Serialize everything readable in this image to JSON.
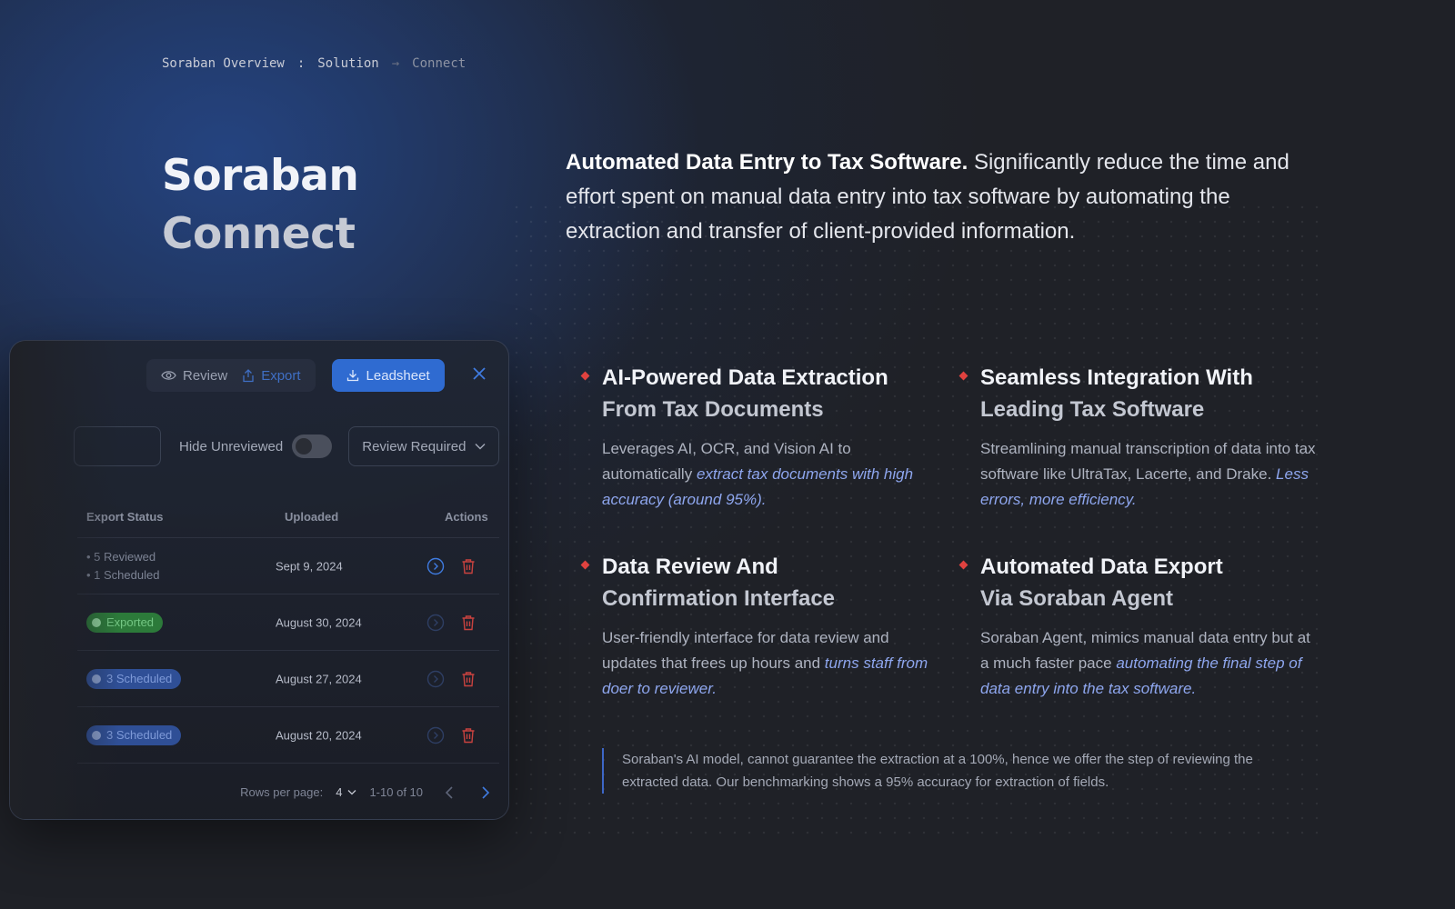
{
  "breadcrumb": {
    "item1": "Soraban Overview",
    "sep1": ":",
    "item2": "Solution",
    "sep2": "→",
    "item3": "Connect"
  },
  "title": {
    "line1": "Soraban",
    "line2": "Connect"
  },
  "intro": {
    "bold": "Automated Data Entry to Tax Software.",
    "rest": " Significantly reduce the time and effort spent on manual data entry into tax software by automating the extraction and transfer of client-provided information."
  },
  "panel": {
    "toolbar": {
      "review": "Review",
      "export": "Export",
      "leadsheet": "Leadsheet"
    },
    "filters": {
      "hide_unreviewed": "Hide Unreviewed",
      "select_value": "Review Required"
    },
    "columns": {
      "status": "Export Status",
      "uploaded": "Uploaded",
      "actions": "Actions"
    },
    "rows": [
      {
        "status_line1": "• 5 Reviewed",
        "status_line2": "• 1 Scheduled",
        "date": "Sept 9, 2024"
      },
      {
        "status": "Exported",
        "date": "August 30, 2024"
      },
      {
        "status": "3 Scheduled",
        "date": "August 27, 2024"
      },
      {
        "status": "3 Scheduled",
        "date": "August 20, 2024"
      }
    ],
    "footer": {
      "rows_per_page": "Rows per page:",
      "rows_value": "4",
      "range": "1-10 of 10"
    }
  },
  "features": [
    {
      "title_a": "AI-Powered Data Extraction",
      "title_b": "From Tax Documents",
      "text": "Leverages AI, OCR, and Vision AI to automatically ",
      "highlight": "extract tax documents with high accuracy (around 95%)."
    },
    {
      "title_a": "Seamless Integration With",
      "title_b": "Leading Tax Software",
      "text": "Streamlining manual transcription of data into tax software like UltraTax, Lacerte, and Drake. ",
      "highlight": "Less errors, more efficiency."
    },
    {
      "title_a": "Data Review And",
      "title_b": "Confirmation Interface",
      "text": "User-friendly interface for data review and updates that frees up hours and ",
      "highlight": "turns staff from doer to reviewer."
    },
    {
      "title_a": "Automated Data Export",
      "title_b": "Via Soraban Agent",
      "text": "Soraban Agent, mimics manual data entry but at a much faster pace  ",
      "highlight": "automating the final step of data entry into the tax software."
    }
  ],
  "note": "Soraban's AI model, cannot guarantee the extraction at a 100%, hence we offer the step of reviewing the extracted data. Our benchmarking shows a 95% accuracy for extraction of fields.",
  "colors": {
    "accent": "#2f6bd1",
    "highlight": "#8ea6ee",
    "diamond": "#e0423f",
    "delete": "#c9423f"
  }
}
